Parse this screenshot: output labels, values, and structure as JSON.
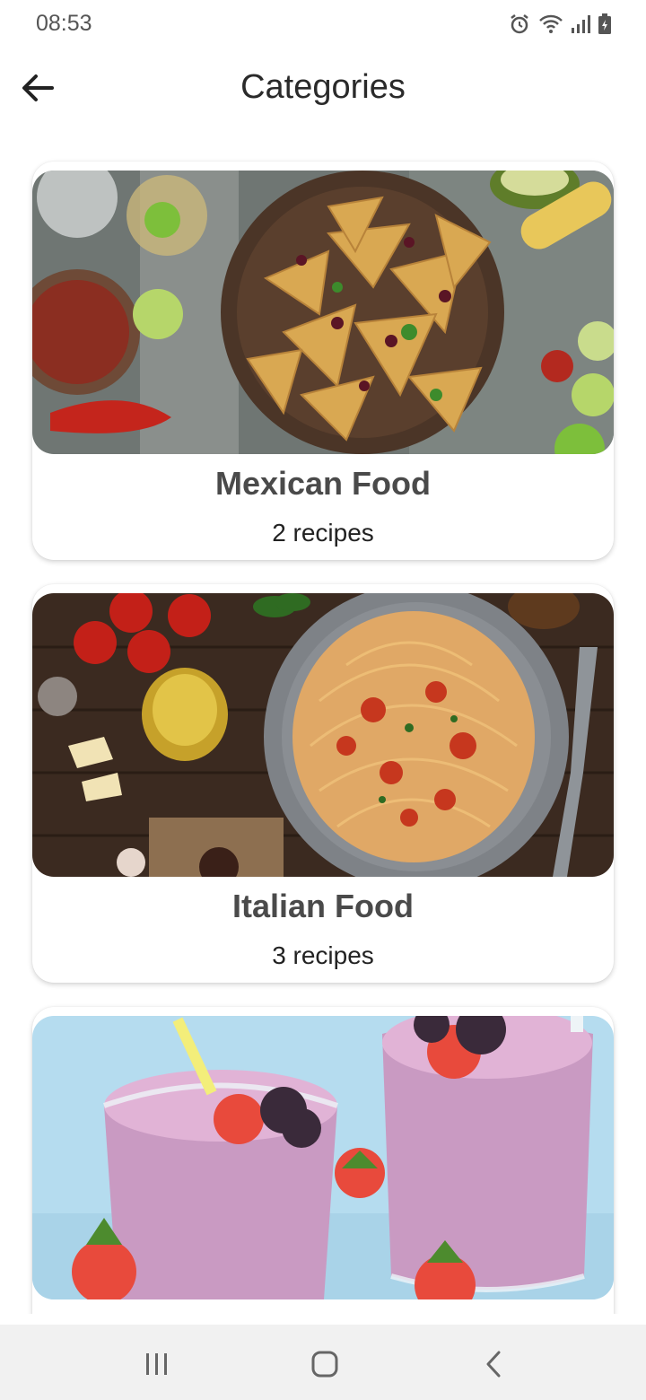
{
  "status_bar": {
    "time": "08:53",
    "icons": [
      "alarm-icon",
      "wifi-icon",
      "signal-icon",
      "battery-icon"
    ]
  },
  "app_bar": {
    "title": "Categories",
    "back_icon": "arrow-left-icon"
  },
  "categories": [
    {
      "title": "Mexican Food",
      "count": "2 recipes",
      "image": "nachos-photo"
    },
    {
      "title": "Italian Food",
      "count": "3 recipes",
      "image": "spaghetti-photo"
    },
    {
      "title": "",
      "count": "",
      "image": "smoothie-photo"
    }
  ],
  "nav_bar": {
    "icons": [
      "recent-apps-icon",
      "home-icon",
      "back-nav-icon"
    ]
  },
  "colors": {
    "background": "#ffffff",
    "title_text": "#4a4a4a",
    "nav_background": "#f1f1f1"
  }
}
